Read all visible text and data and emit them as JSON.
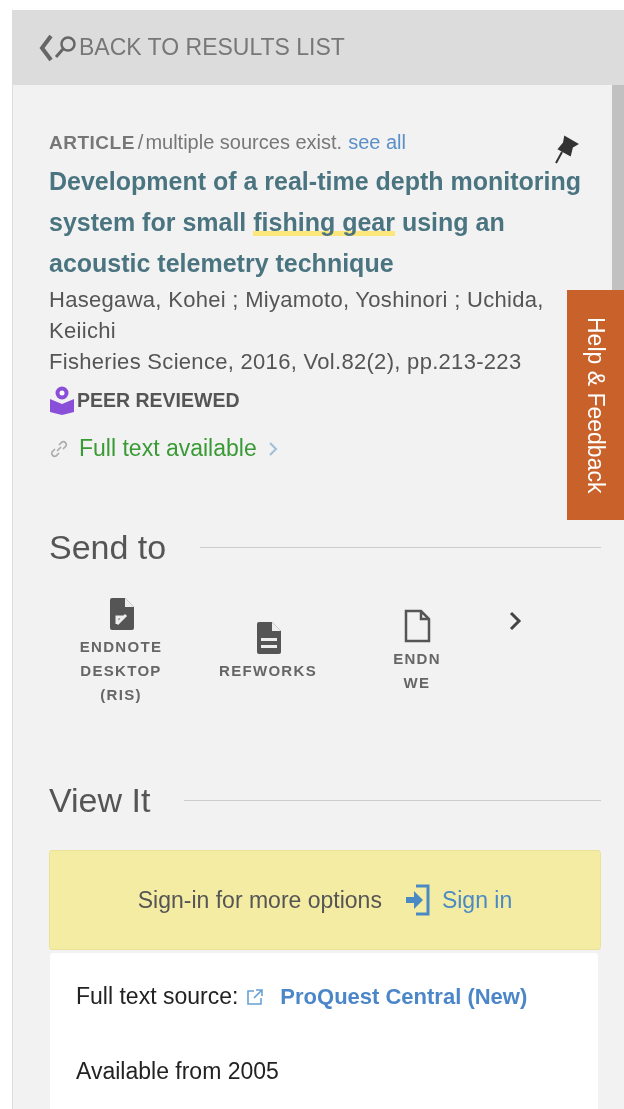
{
  "back_link": {
    "label": "BACK TO RESULTS LIST"
  },
  "record": {
    "type": "ARTICLE",
    "separator": "/",
    "sources_note": "multiple sources exist.",
    "see_all": "see all",
    "title": [
      {
        "text": "Development of a real-time depth monitoring system for small ",
        "highlighted": false
      },
      {
        "text": "fishing gear",
        "highlighted": true
      },
      {
        "text": " using an acoustic telemetry technique",
        "highlighted": false
      }
    ],
    "authors": "Hasegawa, Kohei ; Miyamoto, Yoshinori ; Uchida, Keiichi",
    "source": "Fisheries Science, 2016, Vol.82(2), pp.213-223",
    "peer_reviewed": "PEER REVIEWED",
    "availability": "Full text available"
  },
  "help_tab": "Help & Feedback",
  "send_to": {
    "heading": "Send to",
    "items": [
      {
        "kind": "export",
        "lines": [
          "ENDNOTE",
          "DESKTOP",
          "(RIS)"
        ]
      },
      {
        "kind": "lines",
        "lines": [
          "REFWORKS"
        ]
      },
      {
        "kind": "blank",
        "lines": [
          "ENDN",
          "WE"
        ]
      }
    ]
  },
  "view_it": {
    "heading": "View It",
    "signin_note": "Sign-in for more options",
    "signin_button": "Sign in",
    "source_label": "Full text source:",
    "source_link": "ProQuest Central (New)",
    "available": "Available from 2005"
  }
}
